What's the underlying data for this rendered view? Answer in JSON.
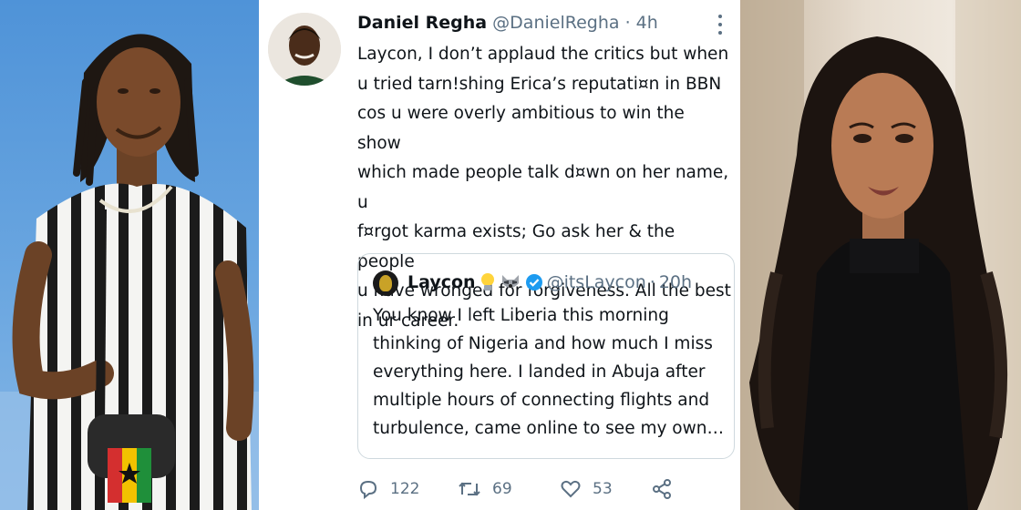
{
  "tweet": {
    "author_name": "Daniel Regha",
    "author_handle": "@DanielRegha",
    "separator": " · ",
    "time": "4h",
    "body_lines": [
      "Laycon, I don’t applaud the critics but when",
      "u tried tarn!shing Erica’s reputati¤n in BBN",
      "cos u were overly ambitious to win the show",
      "which made people talk d¤wn on her name, u",
      "f¤rgot karma exists; Go ask her & the people",
      "u have wronged for forgiveness. All the best",
      "in ur career."
    ],
    "replies": "122",
    "retweets": "69",
    "likes": "53"
  },
  "quoted": {
    "author_name": "Laycon",
    "author_handle": "@itsLaycon",
    "separator": " · ",
    "time": "20h",
    "body_lines": [
      "You know I left Liberia this morning",
      "thinking of Nigeria and how much I miss",
      "everything here. I landed in Abuja after",
      "multiple hours of connecting flights and",
      "turbulence, came online to see my own…"
    ]
  },
  "icons": {
    "more": "more-vertical-icon",
    "reply": "reply-icon",
    "retweet": "retweet-icon",
    "like": "heart-icon",
    "share": "share-icon",
    "bulb": "light-bulb-emoji",
    "raccoon": "raccoon-emoji",
    "verified": "verified-badge-icon"
  },
  "colors": {
    "text": "#0f1419",
    "secondary": "#5b7083",
    "verified": "#1d9bf0",
    "border": "#cfd9de"
  }
}
